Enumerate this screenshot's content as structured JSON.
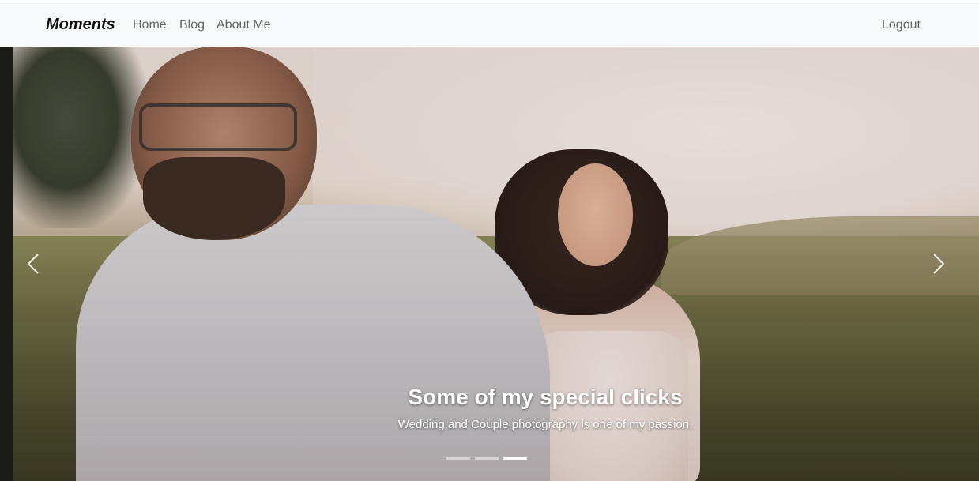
{
  "navbar": {
    "brand": "Moments",
    "links": [
      {
        "label": "Home"
      },
      {
        "label": "Blog"
      },
      {
        "label": "About Me"
      }
    ],
    "logout": "Logout"
  },
  "carousel": {
    "caption_title": "Some of my special clicks",
    "caption_text": "Wedding and Couple photography is one of my passion.",
    "prev_icon": "chevron-left-icon",
    "next_icon": "chevron-right-icon",
    "indicators": {
      "count": 3,
      "active_index": 2
    }
  }
}
